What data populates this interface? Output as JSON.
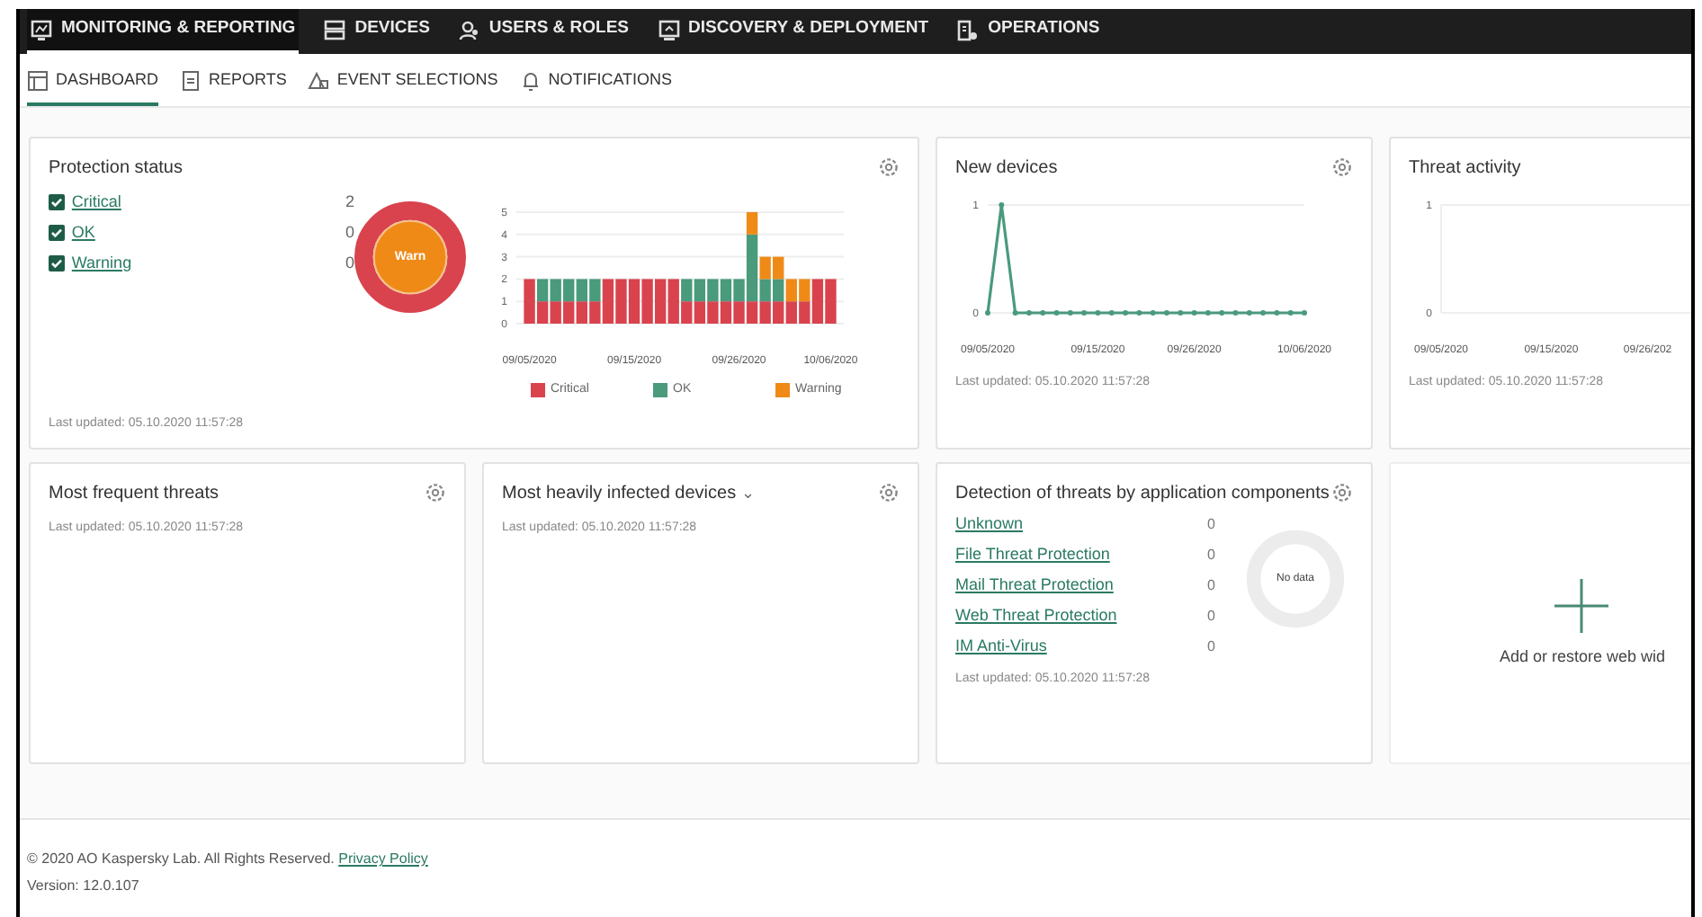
{
  "nav": [
    {
      "label": "MONITORING & REPORTING",
      "selected": true
    },
    {
      "label": "DEVICES",
      "selected": false
    },
    {
      "label": "USERS & ROLES",
      "selected": false
    },
    {
      "label": "DISCOVERY & DEPLOYMENT",
      "selected": false
    },
    {
      "label": "OPERATIONS",
      "selected": false
    }
  ],
  "subnav": [
    {
      "label": "DASHBOARD",
      "selected": true
    },
    {
      "label": "REPORTS",
      "selected": false
    },
    {
      "label": "EVENT SELECTIONS",
      "selected": false
    },
    {
      "label": "NOTIFICATIONS",
      "selected": false
    }
  ],
  "widgets": [
    {
      "kind": "protection",
      "title": "Protection status",
      "settings_button": true,
      "legend": [
        {
          "label": "Critical",
          "checked": true,
          "count": "2"
        },
        {
          "label": "OK",
          "checked": true,
          "count": "0"
        },
        {
          "label": "Warning",
          "checked": true,
          "count": "0"
        }
      ],
      "donut_label": "Warn",
      "chart_data": {
        "type": "bar",
        "stacked": true,
        "categories": [
          "09/05/2020",
          null,
          null,
          null,
          null,
          null,
          null,
          null,
          "09/15/2020",
          null,
          null,
          null,
          null,
          null,
          null,
          null,
          "09/26/2020",
          null,
          null,
          null,
          null,
          null,
          null,
          "10/06/2020"
        ],
        "ylim": [
          0,
          5
        ],
        "yticks": [
          0,
          1,
          2,
          3,
          4,
          5
        ],
        "grid": true,
        "legend": "bottom",
        "series": [
          {
            "name": "Critical",
            "color": "#d9434e",
            "values": [
              2,
              1,
              1,
              1,
              1,
              1,
              2,
              2,
              2,
              2,
              2,
              2,
              1,
              1,
              1,
              1,
              1,
              1,
              1,
              1,
              1,
              1,
              2,
              2
            ]
          },
          {
            "name": "OK",
            "color": "#4a9a7c",
            "values": [
              0,
              1,
              1,
              1,
              1,
              1,
              0,
              0,
              0,
              0,
              0,
              0,
              1,
              1,
              1,
              1,
              1,
              3,
              1,
              1,
              0,
              0,
              0,
              0
            ]
          },
          {
            "name": "Warning",
            "color": "#ef8a17",
            "values": [
              0,
              0,
              0,
              0,
              0,
              0,
              0,
              0,
              0,
              0,
              0,
              0,
              0,
              0,
              0,
              0,
              0,
              1,
              1,
              1,
              1,
              1,
              0,
              0
            ]
          }
        ]
      },
      "last_updated": "Last updated: 05.10.2020 11:57:28"
    },
    {
      "kind": "line",
      "title": "New devices",
      "settings_button": true,
      "chart_data": {
        "type": "line",
        "categories": [
          "09/05/2020",
          null,
          null,
          null,
          null,
          null,
          null,
          null,
          "09/15/2020",
          null,
          null,
          null,
          null,
          null,
          null,
          "09/26/2020",
          null,
          null,
          null,
          null,
          null,
          null,
          null,
          "10/06/2020"
        ],
        "ylim": [
          0,
          1
        ],
        "yticks": [
          0,
          1
        ],
        "grid": true,
        "series": [
          {
            "color": "#4a9a7c",
            "marker": true,
            "values": [
              0,
              1,
              0,
              0,
              0,
              0,
              0,
              0,
              0,
              0,
              0,
              0,
              0,
              0,
              0,
              0,
              0,
              0,
              0,
              0,
              0,
              0,
              0,
              0
            ]
          }
        ]
      },
      "last_updated": "Last updated: 05.10.2020 11:57:28"
    },
    {
      "kind": "line",
      "title": "Threat activity",
      "settings_button": false,
      "chart_data": {
        "type": "line",
        "categories": [
          "09/05/2020",
          null,
          null,
          null,
          null,
          null,
          null,
          null,
          "09/15/2020",
          null,
          null,
          null,
          null,
          null,
          null,
          "09/26/202",
          null,
          null,
          null,
          null,
          null,
          null,
          null,
          null
        ],
        "ylim": [
          0,
          1
        ],
        "yticks": [
          0,
          1
        ],
        "grid": true
      },
      "last_updated": "Last updated: 05.10.2020 11:57:28"
    },
    {
      "kind": "empty",
      "title": "Most frequent threats",
      "settings_button": true,
      "last_updated": "Last updated: 05.10.2020 11:57:28"
    },
    {
      "kind": "empty",
      "title": "Most heavily infected devices",
      "caret": "⌄",
      "settings_button": true,
      "last_updated": "Last updated: 05.10.2020 11:57:28"
    },
    {
      "kind": "components",
      "title": "Detection of threats by application components",
      "settings_button": true,
      "rows": [
        {
          "label": "Unknown",
          "count": "0"
        },
        {
          "label": "File Threat Protection",
          "count": "0"
        },
        {
          "label": "Mail Threat Protection",
          "count": "0"
        },
        {
          "label": "Web Threat Protection",
          "count": "0"
        },
        {
          "label": "IM Anti-Virus",
          "count": "0"
        }
      ],
      "donut_label": "No data",
      "last_updated": "Last updated: 05.10.2020 11:57:28"
    },
    {
      "kind": "add",
      "label": "Add or restore web wid"
    }
  ],
  "footer": {
    "copyright": "© 2020 AO Kaspersky Lab. All Rights Reserved.",
    "link": "Privacy Policy",
    "version": "Version: 12.0.107"
  }
}
